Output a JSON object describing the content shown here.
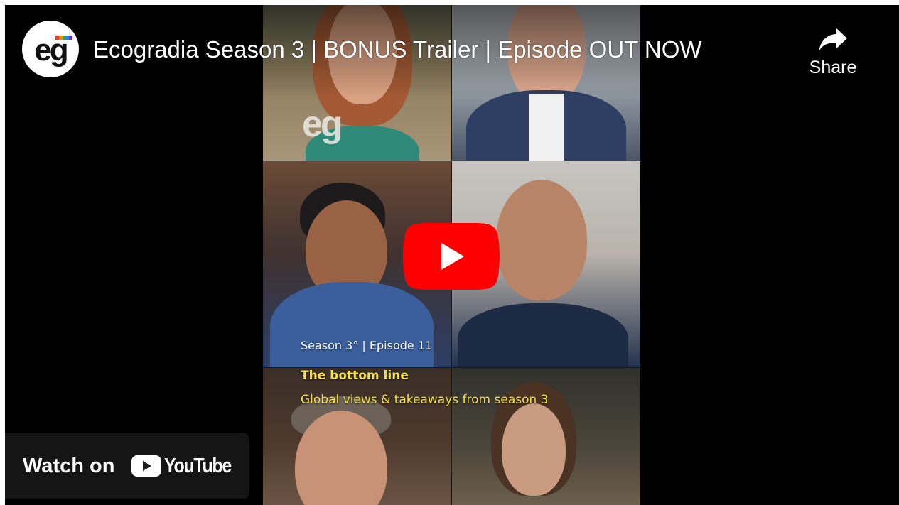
{
  "video": {
    "title": "Ecogradia Season 3 | BONUS Trailer | Episode OUT NOW",
    "channel_logo_text": "eg"
  },
  "share": {
    "label": "Share"
  },
  "thumbnail": {
    "brand_mark": "eg",
    "season_episode": "Season 3° |  Episode 11",
    "headline": "The bottom line",
    "subtitle": "Global views & takeaways from season 3"
  },
  "watch_on": {
    "label": "Watch on",
    "brand": "YouTube"
  },
  "colors": {
    "play_button_red": "#ff0000",
    "caption_yellow": "#f4e04d",
    "player_bg": "#000000",
    "watch_on_bg": "#171717"
  },
  "icons": [
    "share-icon",
    "play-icon",
    "youtube-logo-icon"
  ]
}
